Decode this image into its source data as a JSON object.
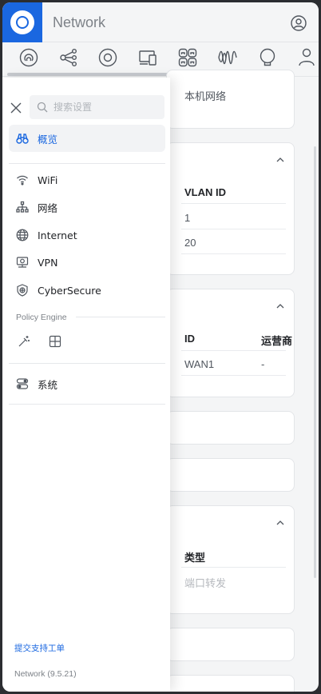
{
  "header": {
    "app_title": "Network",
    "logo_icon": "ubiquiti-logo-icon",
    "user_icon": "user-circle-icon"
  },
  "top_icons": [
    "dashboard-icon",
    "topology-icon",
    "devices-icon",
    "client-devices-icon",
    "ports-icon",
    "insights-icon",
    "hotspot-icon",
    "admins-icon"
  ],
  "background": {
    "card1": {
      "text": "本机网络"
    },
    "card2": {
      "col_header": "VLAN ID",
      "rows": [
        "1",
        "20"
      ]
    },
    "card3": {
      "col_id": "ID",
      "col_carrier": "运营商",
      "row_id": "WAN1",
      "row_carrier": "-"
    },
    "card6": {
      "col_header": "类型",
      "row_value": "端口转发"
    }
  },
  "drawer": {
    "search_placeholder": "搜索设置",
    "search_value": "",
    "items": [
      {
        "label": "概览",
        "icon": "binoculars-icon",
        "active": true
      },
      {
        "label": "WiFi",
        "icon": "wifi-icon"
      },
      {
        "label": "网络",
        "icon": "network-hierarchy-icon"
      },
      {
        "label": "Internet",
        "icon": "globe-icon"
      },
      {
        "label": "VPN",
        "icon": "vpn-icon"
      },
      {
        "label": "CyberSecure",
        "icon": "shield-globe-icon"
      }
    ],
    "policy_engine_label": "Policy Engine",
    "policy_icons": [
      "magic-wand-icon",
      "grid-table-icon"
    ],
    "system_label": "系统",
    "system_icon": "system-toggles-icon",
    "support_link": "提交支持工单",
    "version": "Network (9.5.21)"
  },
  "colors": {
    "accent": "#1a67e0",
    "background": "#f4f5f6",
    "text": "#212327",
    "muted": "#7d8288"
  }
}
